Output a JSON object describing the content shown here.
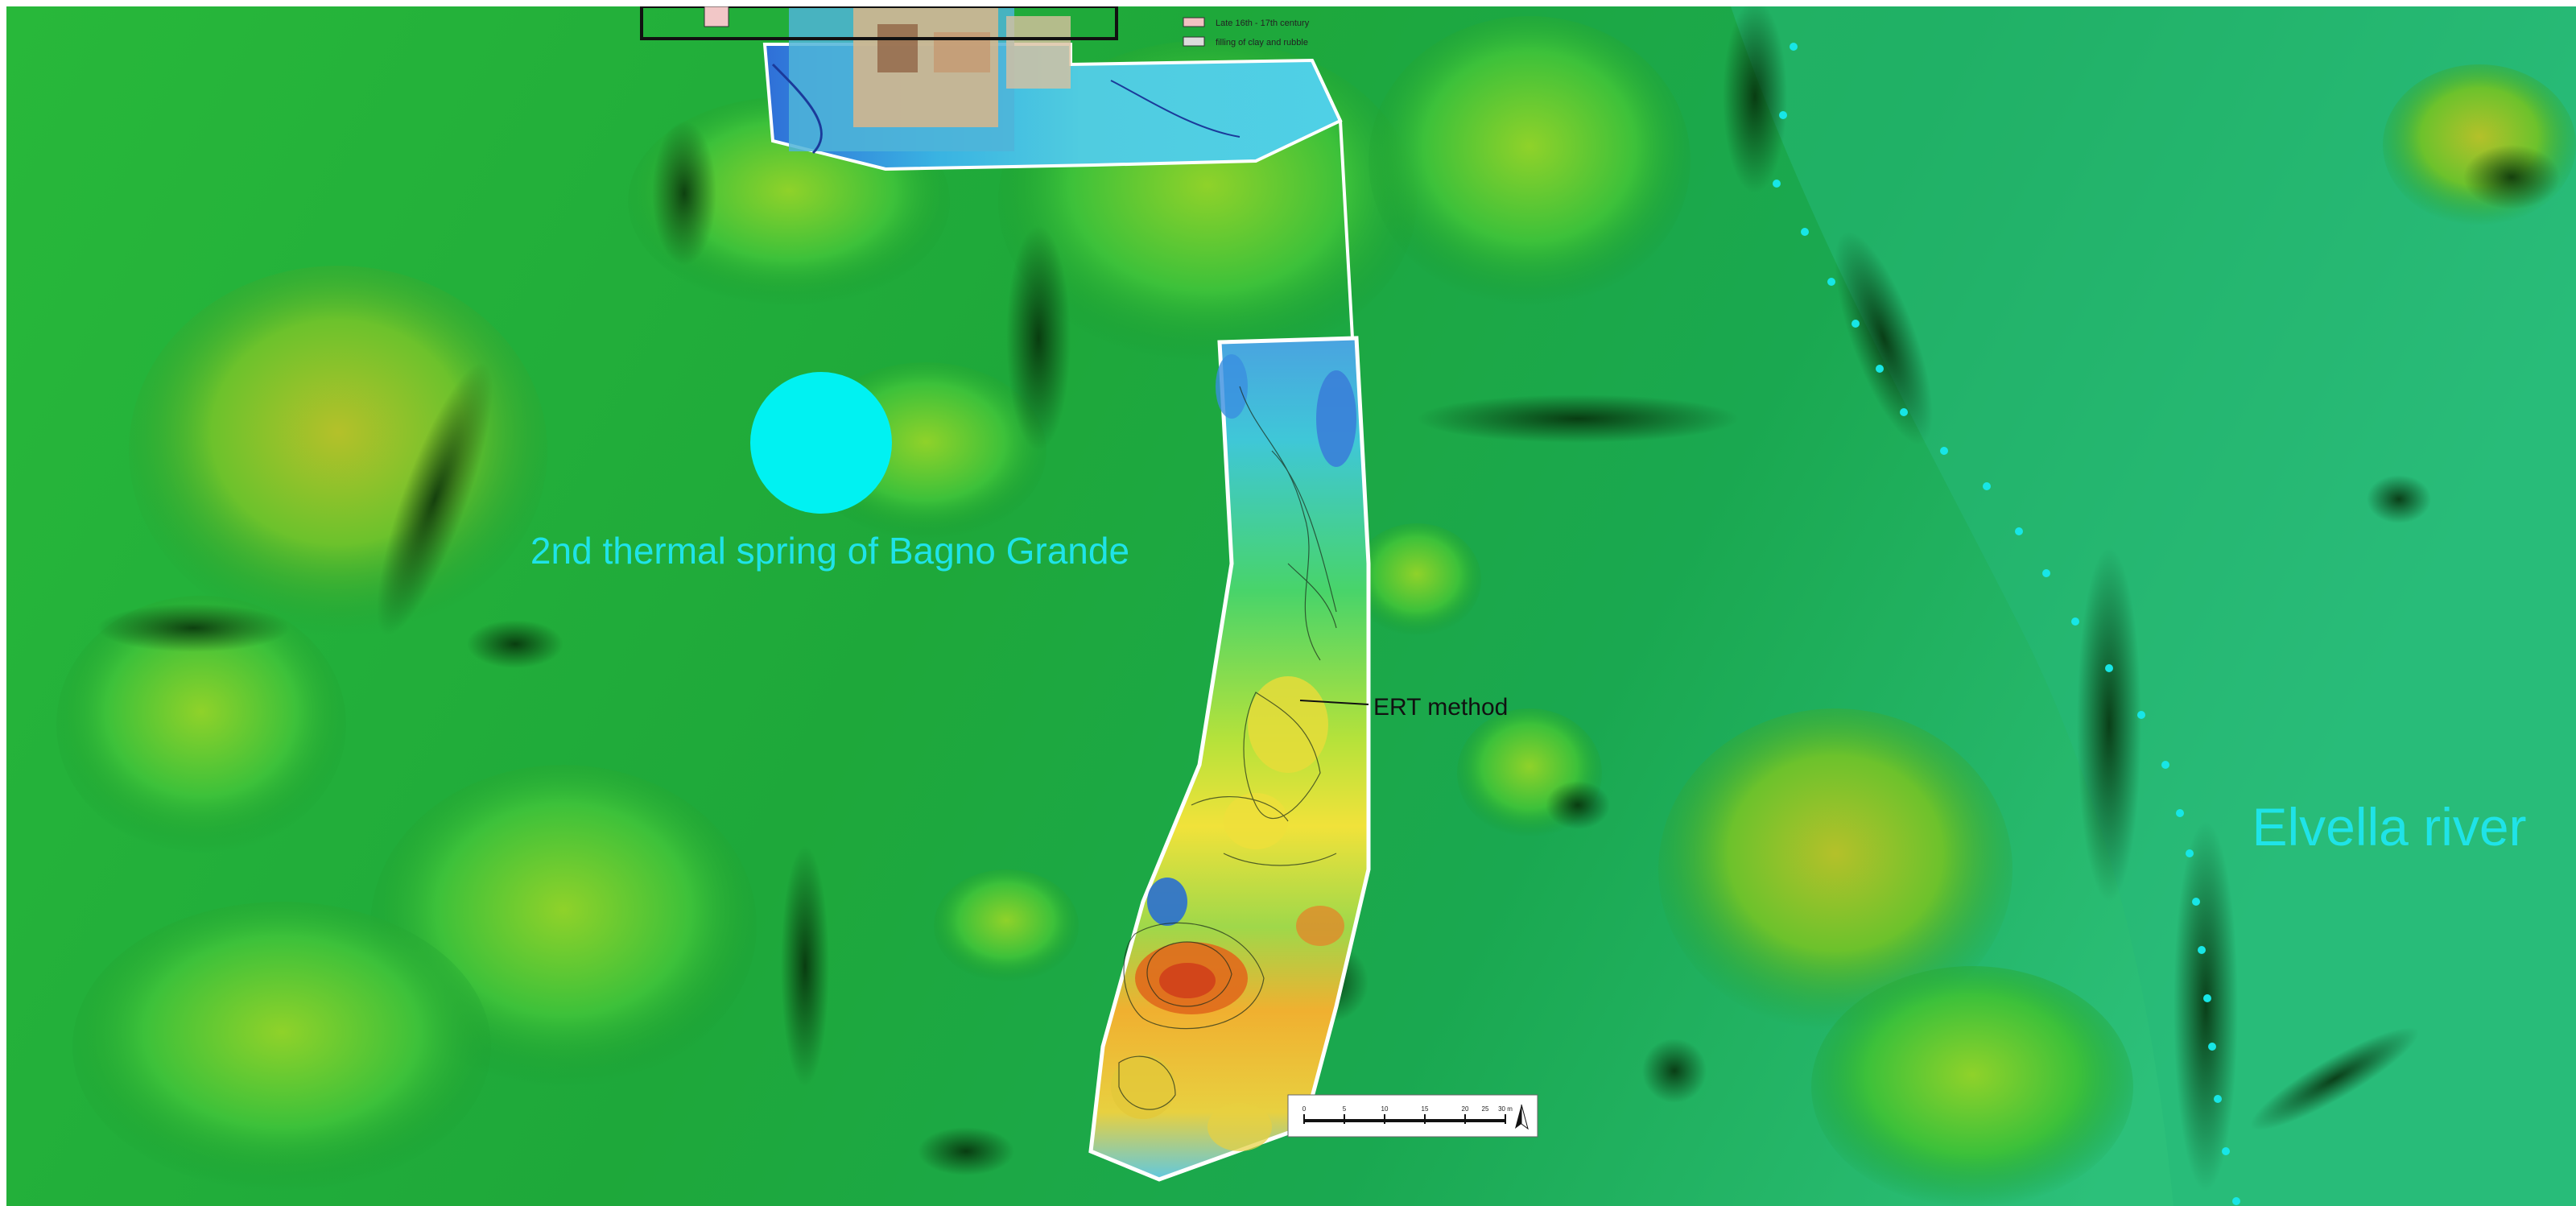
{
  "map": {
    "labels": {
      "spring": "2nd thermal spring of Bagno Grande",
      "river": "Elvella river",
      "ert": "ERT method"
    },
    "legend": {
      "item1": "Late 16th - 17th century",
      "item2": "filling of clay and rubble"
    },
    "scale_bar": {
      "ticks": [
        "0",
        "5",
        "10",
        "15",
        "20",
        "25",
        "30 m"
      ]
    },
    "colors": {
      "terrain": "#22b83a",
      "spring_marker": "#00f2f2",
      "label_cyan": "#1fe3e8",
      "river_dots": "#17e6e6",
      "survey_outline": "#ffffff",
      "ert_label": "#111111"
    },
    "icons": {
      "north_arrow": "north-arrow-icon",
      "spring_marker": "circle-marker-icon"
    }
  }
}
